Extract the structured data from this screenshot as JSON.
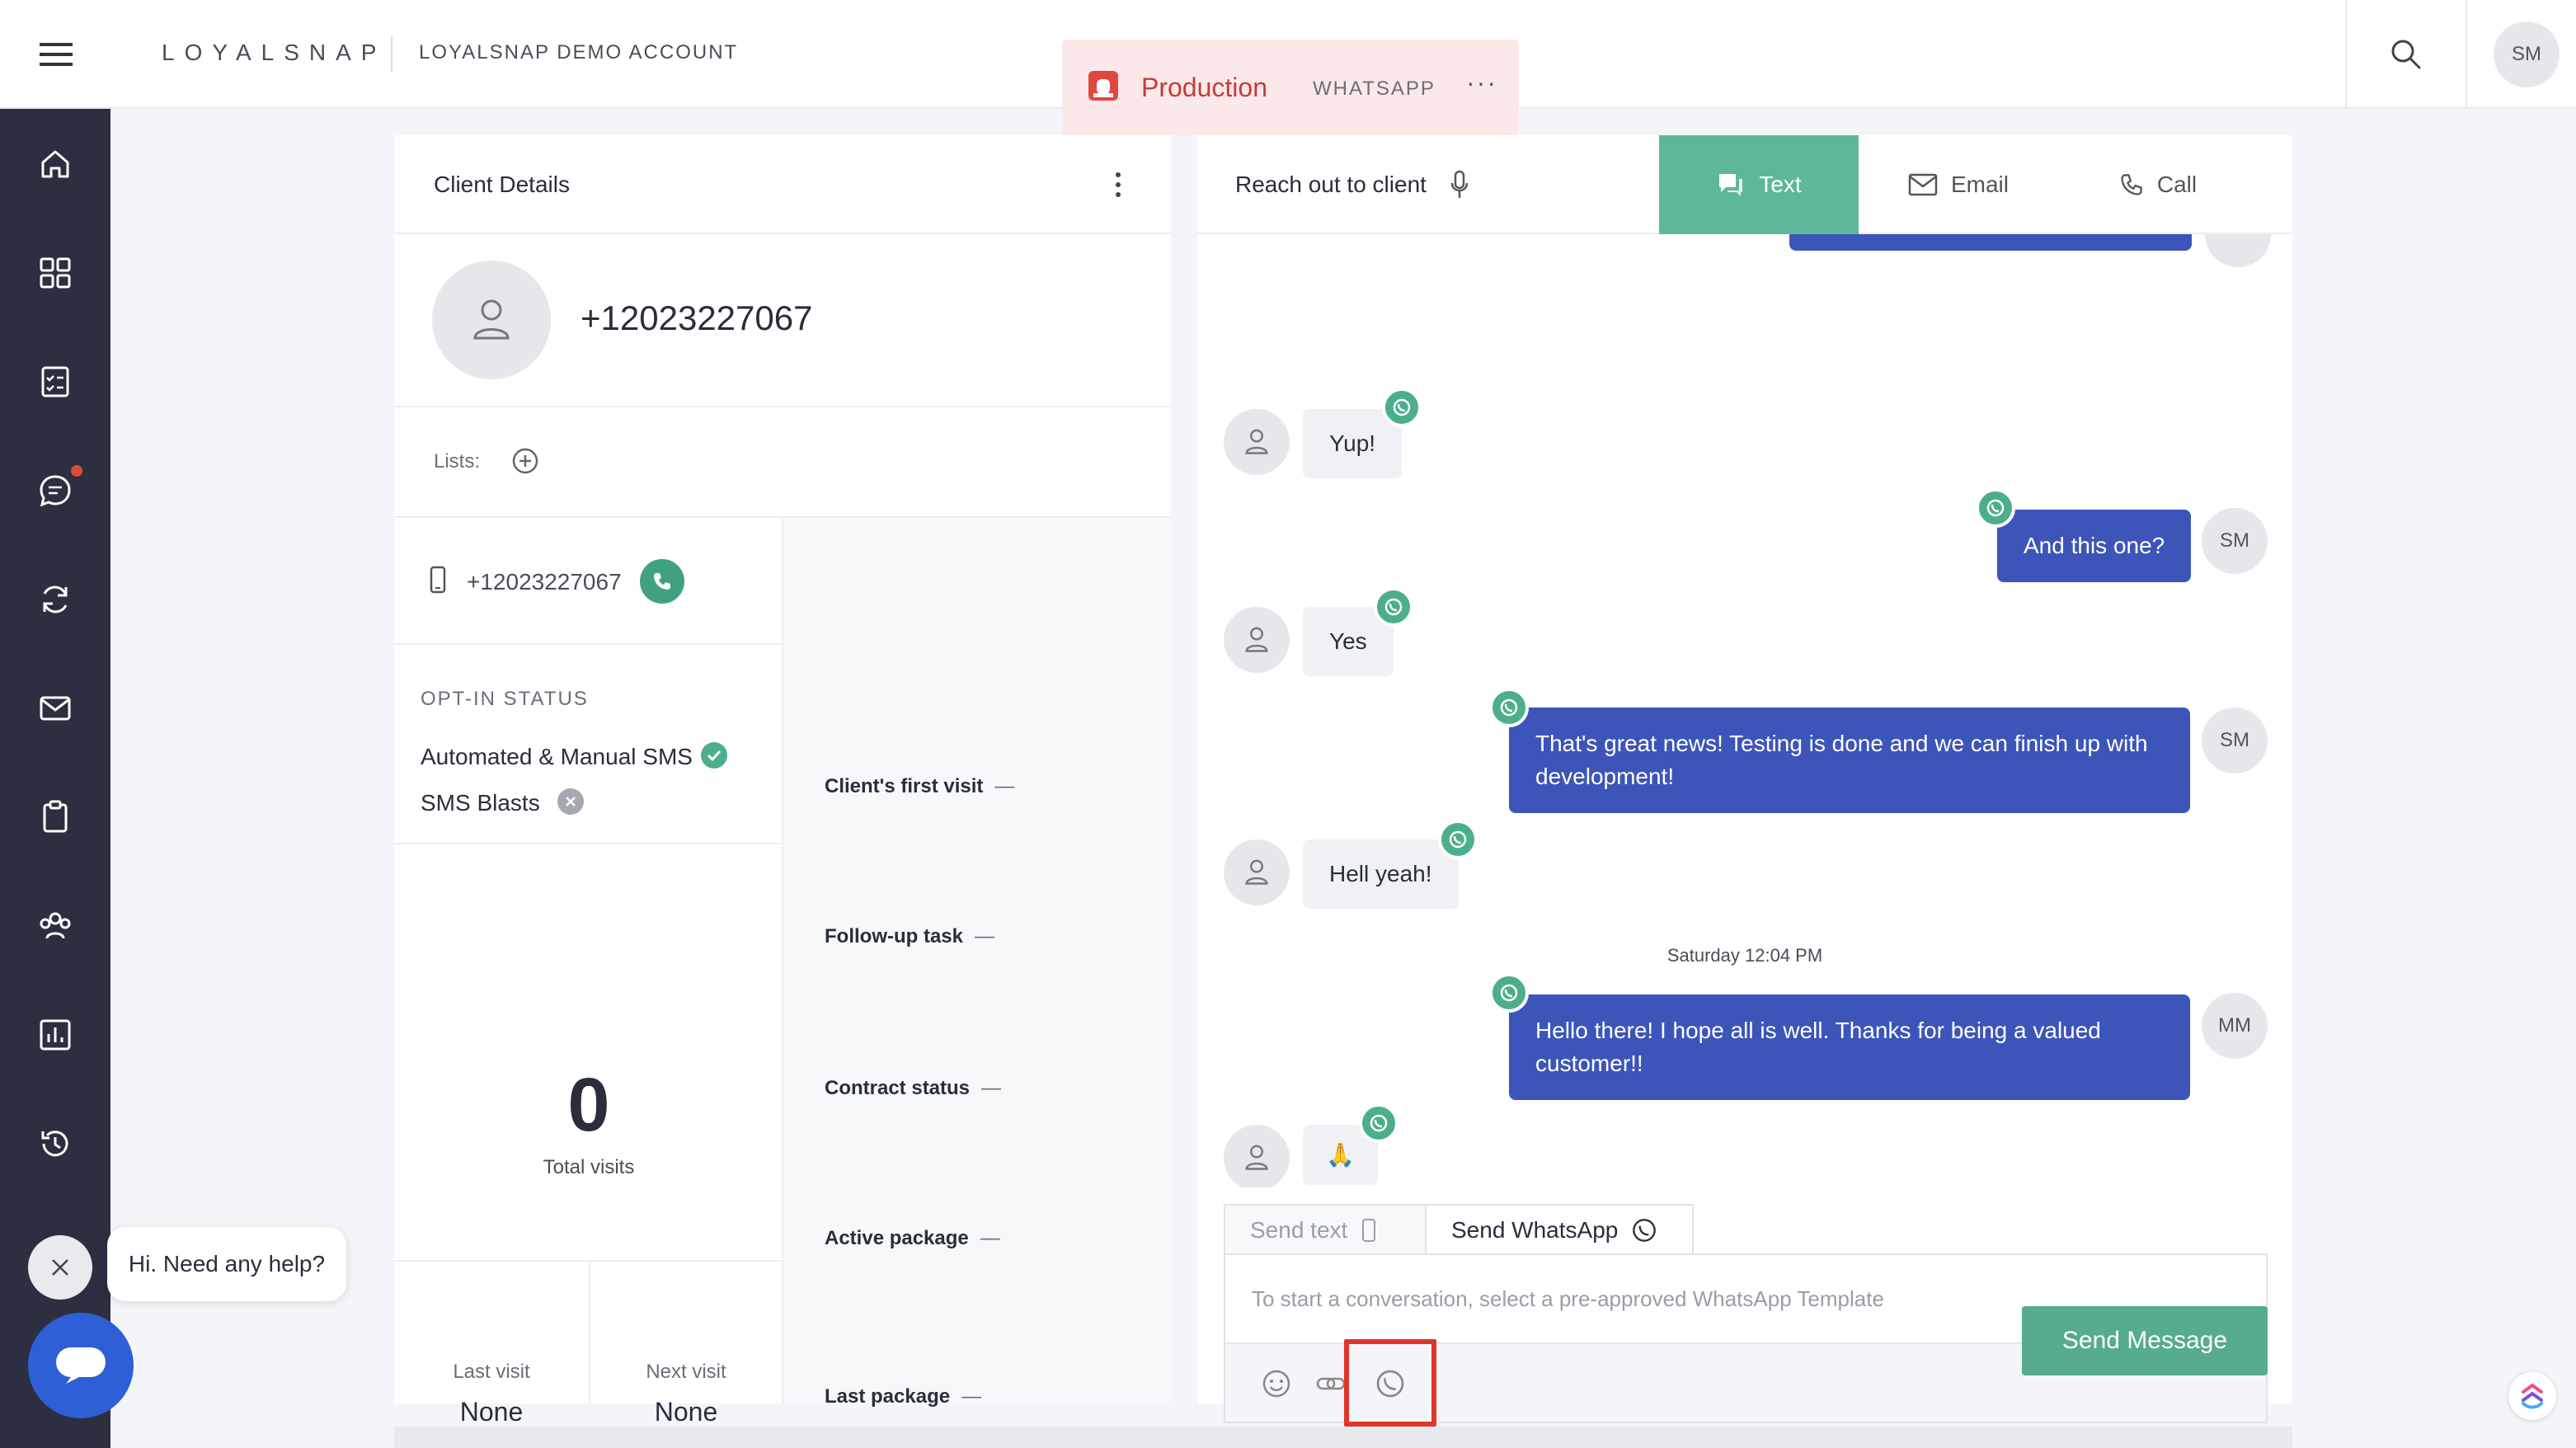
{
  "header": {
    "brand": "LOYALSNAP",
    "account": "LOYALSNAP DEMO ACCOUNT",
    "environment": "Production",
    "channel": "WHATSAPP",
    "more": "···",
    "user_initials": "SM"
  },
  "client": {
    "panel_title": "Client Details",
    "phone": "+12023227067",
    "lists_label": "Lists:",
    "phone_small": "+12023227067",
    "optin_title": "OPT-IN STATUS",
    "optin": [
      {
        "label": "Automated & Manual SMS",
        "status": "opted-in"
      },
      {
        "label": "SMS Blasts",
        "status": "opted-out"
      }
    ],
    "total_visits": "0",
    "total_visits_label": "Total visits",
    "last_visit_label": "Last visit",
    "last_visit": "None",
    "next_visit_label": "Next visit",
    "next_visit": "None",
    "info": [
      {
        "label": "Client's first visit",
        "value": "—"
      },
      {
        "label": "Follow-up task",
        "value": "—"
      },
      {
        "label": "Contract status",
        "value": "—"
      },
      {
        "label": "Active package",
        "value": "—"
      },
      {
        "label": "Last package",
        "value": "—"
      }
    ]
  },
  "reach": {
    "title": "Reach out to client",
    "tabs": {
      "text": "Text",
      "email": "Email",
      "call": "Call"
    },
    "messages": [
      {
        "dir": "in",
        "text": "Yup!"
      },
      {
        "dir": "out",
        "text": "And this one?",
        "initials": "SM"
      },
      {
        "dir": "in",
        "text": "Yes"
      },
      {
        "dir": "out",
        "text": "That's great news! Testing is done and we can finish up with development!",
        "initials": "SM"
      },
      {
        "dir": "in",
        "text": "Hell yeah!"
      },
      {
        "dir": "out",
        "text": "Hello there! I hope all is well. Thanks for being a valued customer!!",
        "initials": "MM"
      },
      {
        "dir": "in",
        "text": "🙏"
      }
    ],
    "date_separator": "Saturday 12:04 PM",
    "composer": {
      "tab_send_text": "Send text",
      "tab_send_whatsapp": "Send WhatsApp",
      "placeholder": "To start a conversation, select a pre-approved WhatsApp Template",
      "send_label": "Send Message"
    }
  },
  "help": {
    "bubble_text": "Hi. Need any help?"
  },
  "colors": {
    "sidebar": "#2b2f3f",
    "accent_green": "#5fb79a",
    "outgoing_bubble": "#3d55b8",
    "highlight_red": "#e0352b"
  }
}
